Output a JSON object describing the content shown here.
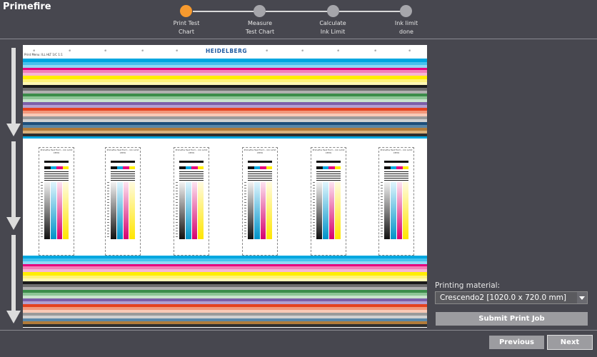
{
  "app": {
    "title": "Primefire"
  },
  "steps": [
    {
      "label": "Print Test Chart",
      "line1": "Print Test",
      "line2": "Chart",
      "state": "active"
    },
    {
      "label": "Measure Test Chart",
      "line1": "Measure",
      "line2": "Test Chart",
      "state": "pending"
    },
    {
      "label": "Calculate Ink Limit",
      "line1": "Calculate",
      "line2": "Ink Limit",
      "state": "pending"
    },
    {
      "label": "Ink limit done",
      "line1": "Ink limit",
      "line2": "done",
      "state": "pending"
    }
  ],
  "test_chart": {
    "brand_logo": "HEIDELBERG",
    "header_text": "Print Menu: ILL HLT 1/C 1:1",
    "strip_title": "Primefire Test Form - Ink Limit CMYK"
  },
  "side_panel": {
    "printing_material_label": "Printing material:",
    "printing_material_value": "Crescendo2 [1020.0 x 720.0 mm]",
    "submit_label": "Submit Print Job"
  },
  "footer": {
    "previous_label": "Previous",
    "next_label": "Next"
  },
  "colors": {
    "active_step": "#f79a2e",
    "pending_step": "#a6a6ab",
    "background": "#47474f",
    "button": "#9c9ca0"
  }
}
